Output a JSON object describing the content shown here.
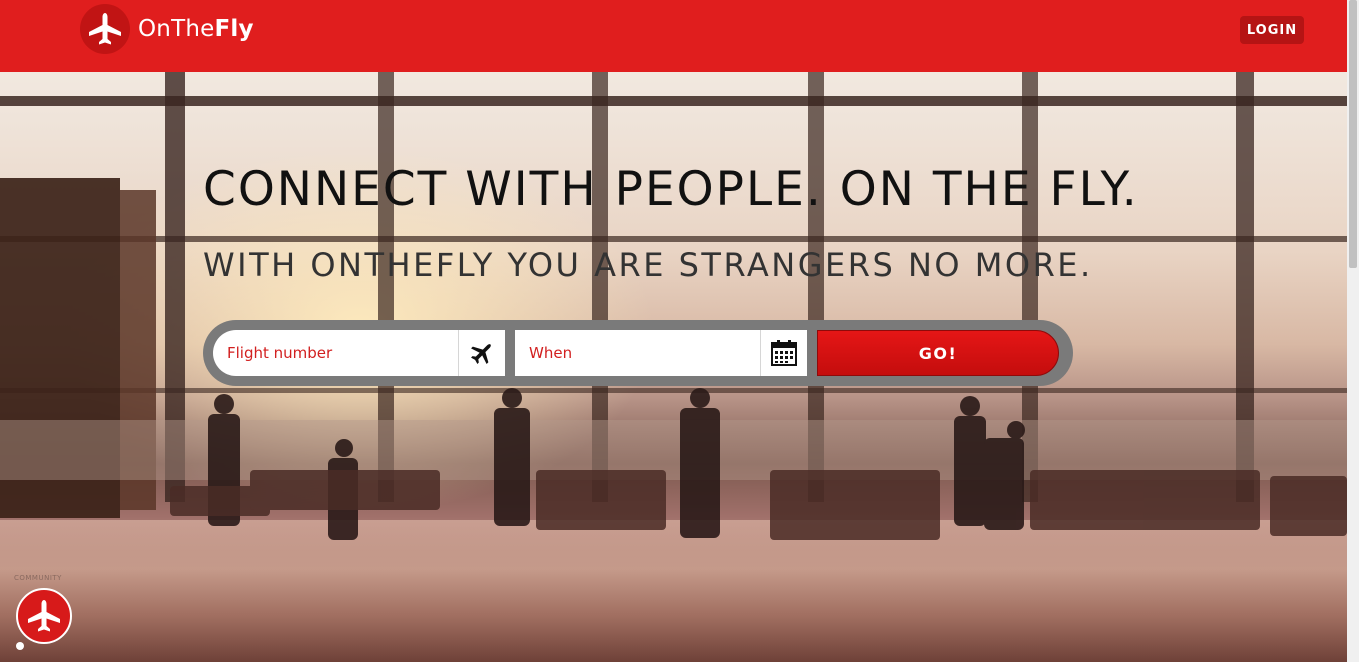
{
  "brand": {
    "name_light": "OnThe",
    "name_bold": "Fly",
    "primary_color": "#e01e1e",
    "logo_icon": "airplane-icon"
  },
  "header": {
    "login_label": "LOGIN"
  },
  "hero": {
    "headline": "CONNECT WITH PEOPLE. ON THE FLY.",
    "subheadline": "WITH ONTHEFLY YOU ARE STRANGERS NO MORE."
  },
  "search": {
    "flight_placeholder": "Flight number",
    "flight_icon": "airplane-icon",
    "when_placeholder": "When",
    "when_icon": "calendar-icon",
    "go_label": "GO!"
  },
  "community_badge": {
    "label": "COMMUNITY",
    "icon": "airplane-icon"
  }
}
